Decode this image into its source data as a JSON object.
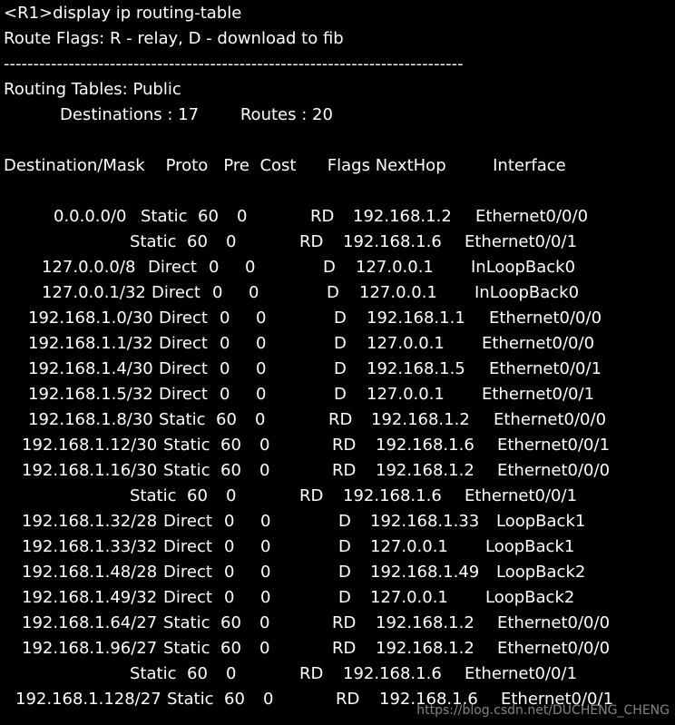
{
  "terminal": {
    "command_line": "<R1>display ip routing-table",
    "route_flags": "Route Flags: R - relay, D - download to fib",
    "separator": "------------------------------------------------------------------------------",
    "table_title": "Routing Tables: Public",
    "summary": "Destinations : 17        Routes : 20",
    "header": "Destination/Mask    Proto   Pre  Cost      Flags NextHop         Interface",
    "routes": [
      {
        "dest": "0.0.0.0/0",
        "proto": "Static",
        "pre": "60",
        "cost": "0",
        "flags": "RD",
        "nexthop": "192.168.1.2",
        "iface": "Ethernet0/0/0"
      },
      {
        "dest": "",
        "proto": "Static",
        "pre": "60",
        "cost": "0",
        "flags": "RD",
        "nexthop": "192.168.1.6",
        "iface": "Ethernet0/0/1"
      },
      {
        "dest": "127.0.0.0/8",
        "proto": "Direct",
        "pre": "0",
        "cost": "0",
        "flags": "D",
        "nexthop": "127.0.0.1",
        "iface": "InLoopBack0"
      },
      {
        "dest": "127.0.0.1/32",
        "proto": "Direct",
        "pre": "0",
        "cost": "0",
        "flags": "D",
        "nexthop": "127.0.0.1",
        "iface": "InLoopBack0"
      },
      {
        "dest": "192.168.1.0/30",
        "proto": "Direct",
        "pre": "0",
        "cost": "0",
        "flags": "D",
        "nexthop": "192.168.1.1",
        "iface": "Ethernet0/0/0"
      },
      {
        "dest": "192.168.1.1/32",
        "proto": "Direct",
        "pre": "0",
        "cost": "0",
        "flags": "D",
        "nexthop": "127.0.0.1",
        "iface": "Ethernet0/0/0"
      },
      {
        "dest": "192.168.1.4/30",
        "proto": "Direct",
        "pre": "0",
        "cost": "0",
        "flags": "D",
        "nexthop": "192.168.1.5",
        "iface": "Ethernet0/0/1"
      },
      {
        "dest": "192.168.1.5/32",
        "proto": "Direct",
        "pre": "0",
        "cost": "0",
        "flags": "D",
        "nexthop": "127.0.0.1",
        "iface": "Ethernet0/0/1"
      },
      {
        "dest": "192.168.1.8/30",
        "proto": "Static",
        "pre": "60",
        "cost": "0",
        "flags": "RD",
        "nexthop": "192.168.1.2",
        "iface": "Ethernet0/0/0"
      },
      {
        "dest": "192.168.1.12/30",
        "proto": "Static",
        "pre": "60",
        "cost": "0",
        "flags": "RD",
        "nexthop": "192.168.1.6",
        "iface": "Ethernet0/0/1"
      },
      {
        "dest": "192.168.1.16/30",
        "proto": "Static",
        "pre": "60",
        "cost": "0",
        "flags": "RD",
        "nexthop": "192.168.1.2",
        "iface": "Ethernet0/0/0"
      },
      {
        "dest": "",
        "proto": "Static",
        "pre": "60",
        "cost": "0",
        "flags": "RD",
        "nexthop": "192.168.1.6",
        "iface": "Ethernet0/0/1"
      },
      {
        "dest": "192.168.1.32/28",
        "proto": "Direct",
        "pre": "0",
        "cost": "0",
        "flags": "D",
        "nexthop": "192.168.1.33",
        "iface": "LoopBack1"
      },
      {
        "dest": "192.168.1.33/32",
        "proto": "Direct",
        "pre": "0",
        "cost": "0",
        "flags": "D",
        "nexthop": "127.0.0.1",
        "iface": "LoopBack1"
      },
      {
        "dest": "192.168.1.48/28",
        "proto": "Direct",
        "pre": "0",
        "cost": "0",
        "flags": "D",
        "nexthop": "192.168.1.49",
        "iface": "LoopBack2"
      },
      {
        "dest": "192.168.1.49/32",
        "proto": "Direct",
        "pre": "0",
        "cost": "0",
        "flags": "D",
        "nexthop": "127.0.0.1",
        "iface": "LoopBack2"
      },
      {
        "dest": "192.168.1.64/27",
        "proto": "Static",
        "pre": "60",
        "cost": "0",
        "flags": "RD",
        "nexthop": "192.168.1.2",
        "iface": "Ethernet0/0/0"
      },
      {
        "dest": "192.168.1.96/27",
        "proto": "Static",
        "pre": "60",
        "cost": "0",
        "flags": "RD",
        "nexthop": "192.168.1.2",
        "iface": "Ethernet0/0/0"
      },
      {
        "dest": "",
        "proto": "Static",
        "pre": "60",
        "cost": "0",
        "flags": "RD",
        "nexthop": "192.168.1.6",
        "iface": "Ethernet0/0/1"
      },
      {
        "dest": "192.168.1.128/27",
        "proto": "Static",
        "pre": "60",
        "cost": "0",
        "flags": "RD",
        "nexthop": "192.168.1.6",
        "iface": "Ethernet0/0/1"
      }
    ],
    "watermark": "https://blog.csdn.net/DUCHENG_CHENG"
  }
}
